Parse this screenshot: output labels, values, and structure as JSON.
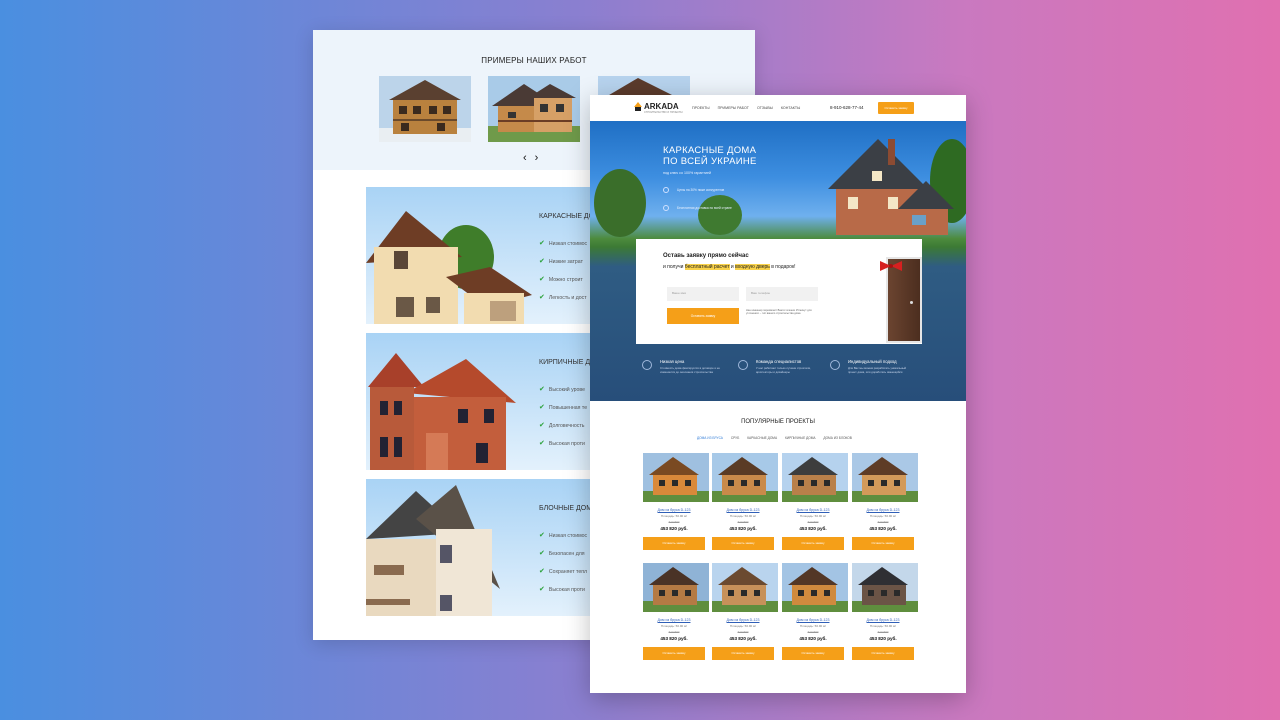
{
  "back": {
    "gallery_title": "ПРИМЕРЫ НАШИХ РАБОТ",
    "arrows": "‹ ›",
    "categories": [
      {
        "title": "КАРКАСНЫЕ ДО",
        "items": [
          "Низкая стоимос",
          "Низкие затрат",
          "Можно строит",
          "Легкость и дост"
        ]
      },
      {
        "title": "КИРПИЧНЫЕ Д",
        "items": [
          "Высокий урове",
          "Повышенная те",
          "Долговечность",
          "Высокая проти"
        ]
      },
      {
        "title": "БЛОЧНЫЕ ДОМ",
        "items": [
          "Низкая стоимос",
          "Безопасен для",
          "Сохраняет тепл",
          "Высокая проти"
        ]
      }
    ]
  },
  "front": {
    "logo": "ARKADA",
    "logo_sub": "СТРОИТЕЛЬСТВО И ПРОЕКТЫ",
    "nav": [
      "ПРОЕКТЫ",
      "ПРИМЕРЫ РАБОТ",
      "ОТЗЫВЫ",
      "КОНТАКТЫ"
    ],
    "phone": "8-910-628-77-44",
    "header_cta": "Оставить заявку",
    "hero": {
      "title_line1": "КАРКАСНЫЕ ДОМА",
      "title_line2": "ПО ВСЕЙ УКРАИНЕ",
      "subtitle": "под ключ со 100% гарантией",
      "point1": "Цены на 30% ниже конкурентов",
      "point2": "Бесплатная доставка по всей стране"
    },
    "form": {
      "heading": "Оставь заявку прямо сейчас",
      "sub_pre": "и получи",
      "sub_hl1": "бесплатный расчет",
      "sub_mid": "и",
      "sub_hl2": "входную дверь",
      "sub_post": "в подарок!",
      "name_placeholder": "Ваше имя",
      "phone_placeholder": "Ваш телефон",
      "button": "Оставить заявку",
      "note": "Наш инженер перезвонит Вам в течение 15 минут для уточнения: – тип вашего строительства дома"
    },
    "features": [
      {
        "title": "Низкая цена",
        "desc": "Стоимость дома фиксируется в договоре и не изменяется до окончания строительства"
      },
      {
        "title": "Команда специалистов",
        "desc": "У нас работают только лучшие строители, архитекторы и дизайнеры"
      },
      {
        "title": "Индивидуальный подход",
        "desc": "Для Вас мы можем разработать уникальный проект дома, или доработать имеющийся"
      }
    ],
    "popular_title": "ПОПУЛЯРНЫЕ ПРОЕКТЫ",
    "tabs": [
      "ДОМА ИЗ БРУСА",
      "СРУБ",
      "КАРКАСНЫЕ ДОМА",
      "КИРПИЧНЫЕ ДОМА",
      "ДОМА ИЗ БЛОКОВ"
    ],
    "card": {
      "name": "Дом из бруса D-123",
      "area": "Площадь: 50.90 м²",
      "old_price": "613 800",
      "price": "453 820 руб.",
      "button": "Оставить заявку"
    }
  },
  "colors": {
    "accent": "#f59f18",
    "link": "#2f5fb7",
    "check": "#2ca23b"
  }
}
